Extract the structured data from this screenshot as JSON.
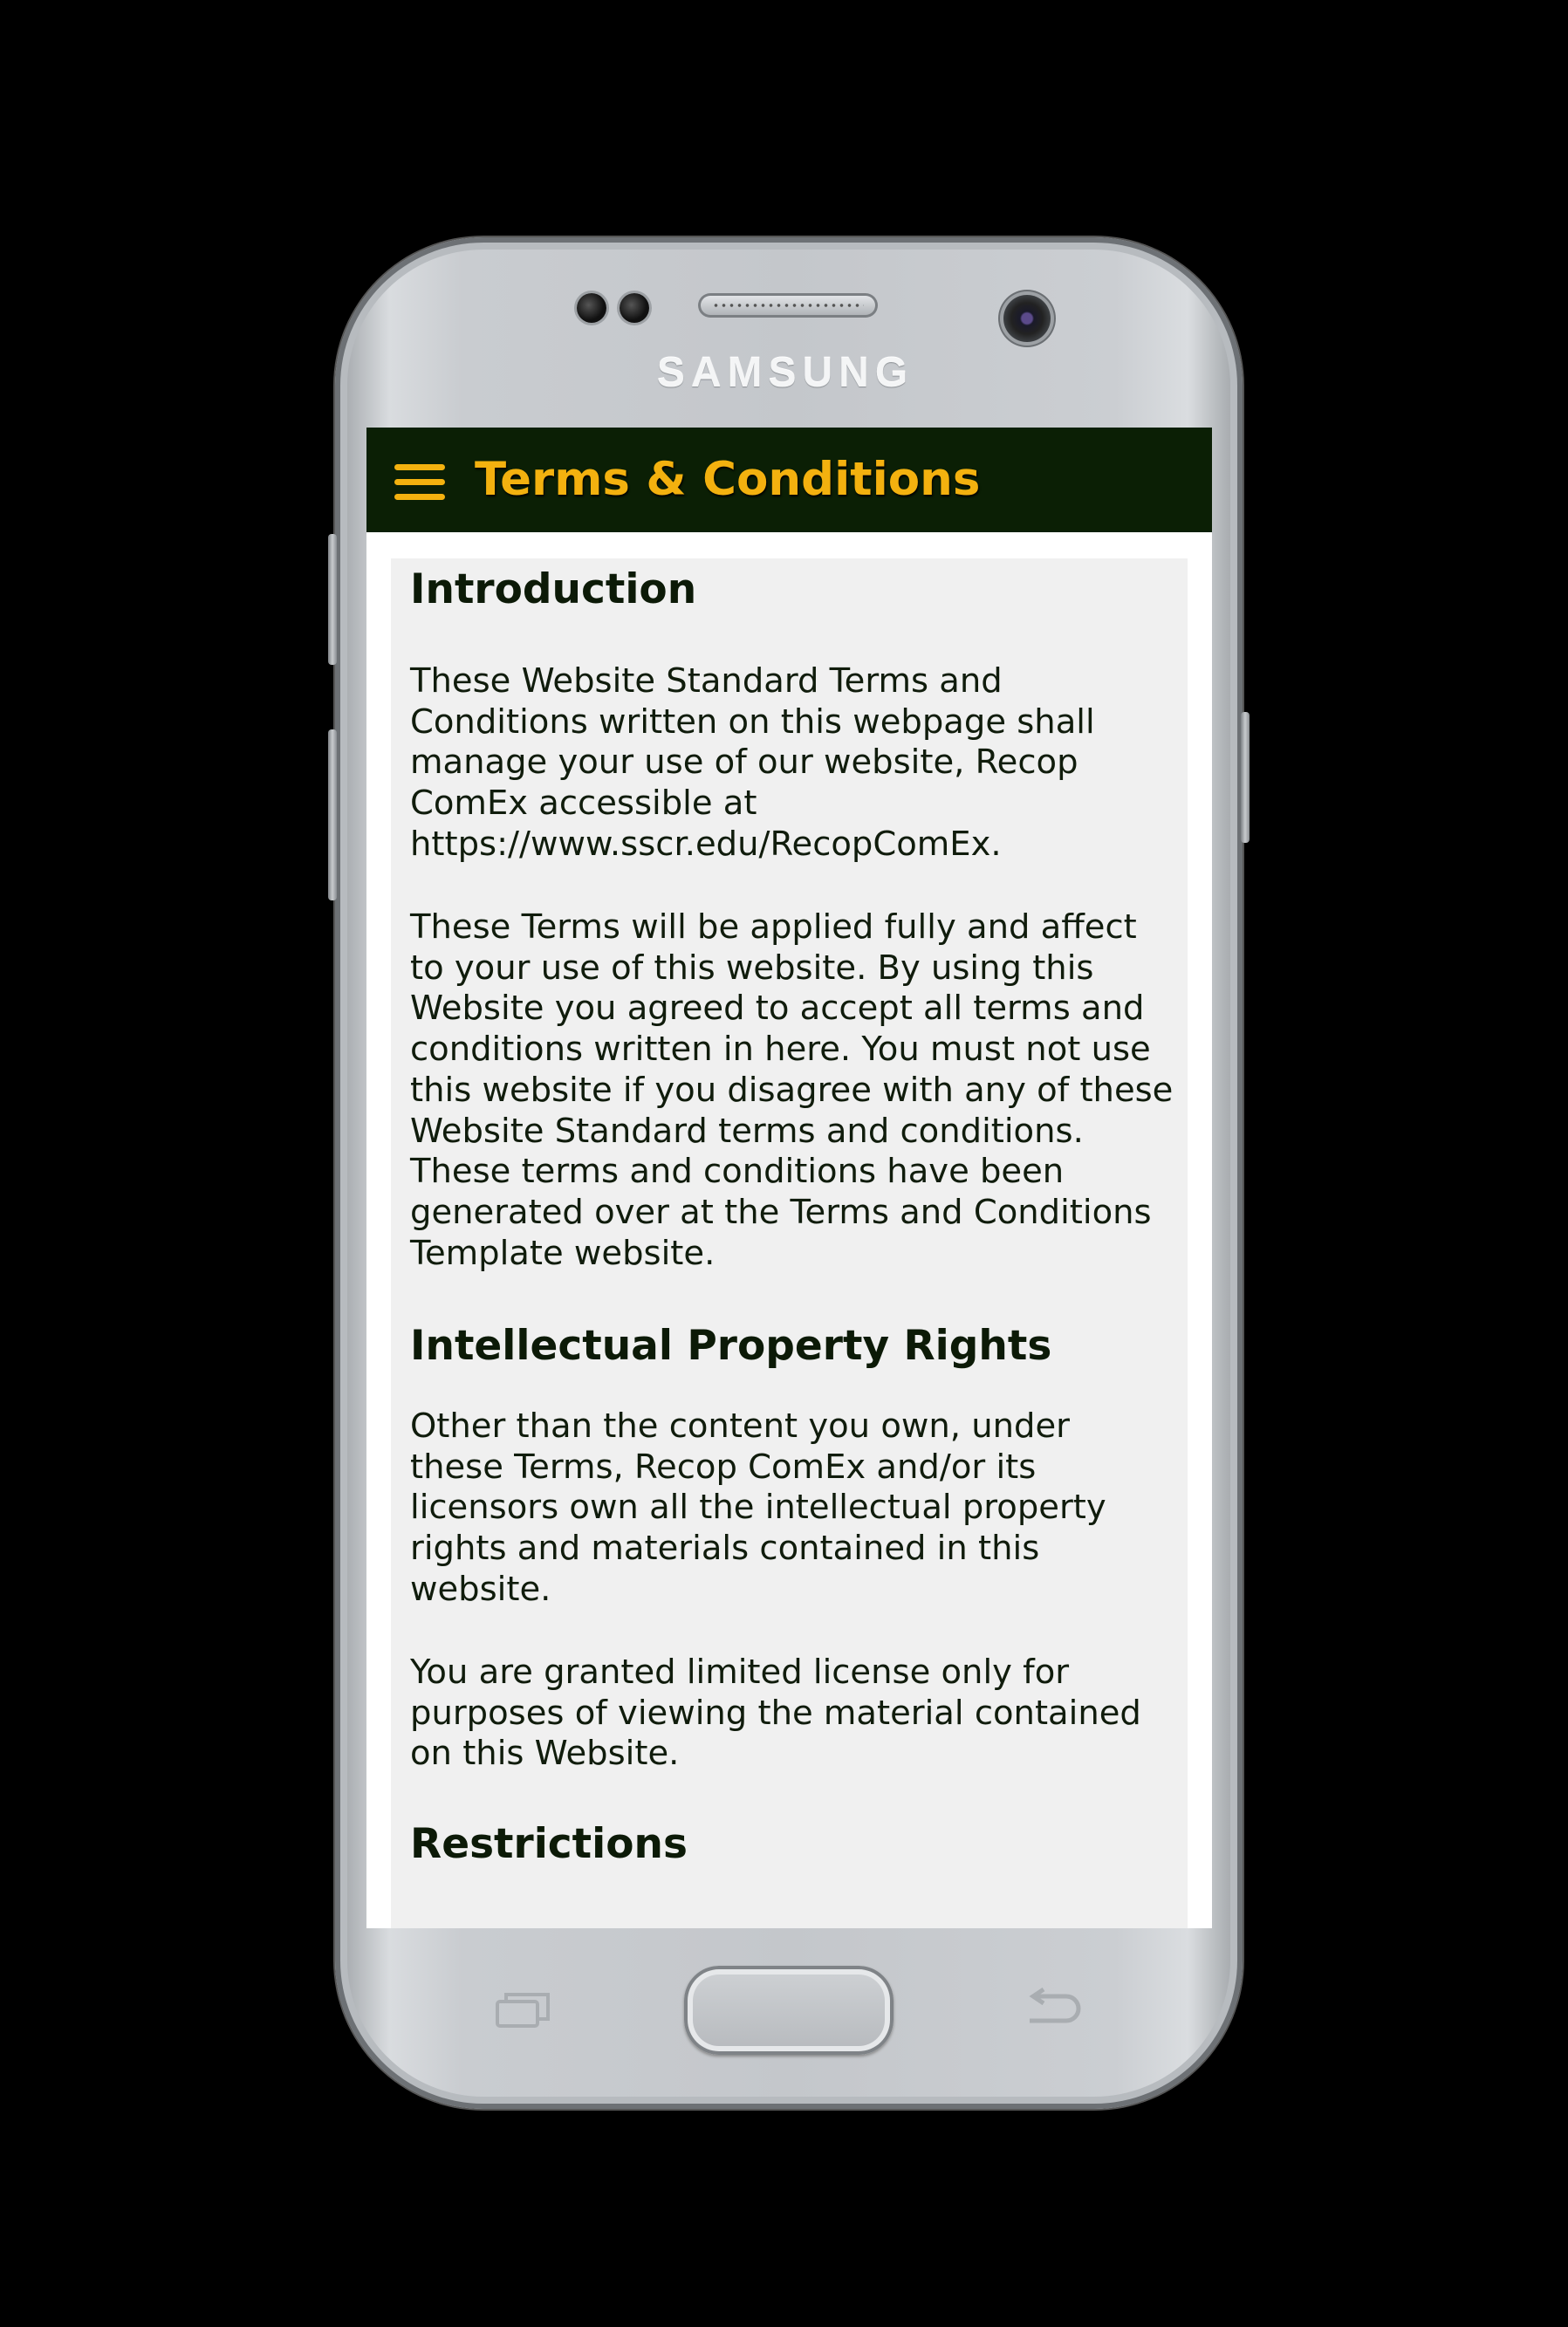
{
  "device": {
    "brand": "SAMSUNG"
  },
  "app_bar": {
    "title": "Terms & Conditions",
    "menu_icon": "hamburger-menu-icon",
    "background_color": "#0b1f05",
    "accent_color": "#f3b10f"
  },
  "content": {
    "sections": [
      {
        "heading": "Introduction",
        "paragraphs": [
          "These Website Standard Terms and\nConditions written on this webpage shall\nmanage your use of our website, Recop\n ComEx accessible at\nhttps://www.sscr.edu/RecopComEx.",
          "These Terms will be applied fully and affect\nto your use of this website. By using  this\nWebsite you agreed to accept all terms and\nconditions written in here. You must not use\nthis website if you disagree with any of these\nWebsite Standard terms and conditions.\nThese terms and conditions have been\ngenerated over at the Terms and Conditions\nTemplate website."
        ]
      },
      {
        "heading": "Intellectual Property Rights",
        "paragraphs": [
          "Other than the content you own, under\nthese Terms, Recop ComEx and/or its\nlicensors own all the intellectual property\nrights and materials contained in this\nwebsite.",
          "You are granted limited license only for\npurposes of viewing the material contained\non this Website."
        ]
      },
      {
        "heading": "Restrictions",
        "paragraphs": []
      }
    ]
  },
  "hardware_keys": {
    "recent": "recent-apps-icon",
    "home": "home-button",
    "back": "back-arrow-icon"
  }
}
